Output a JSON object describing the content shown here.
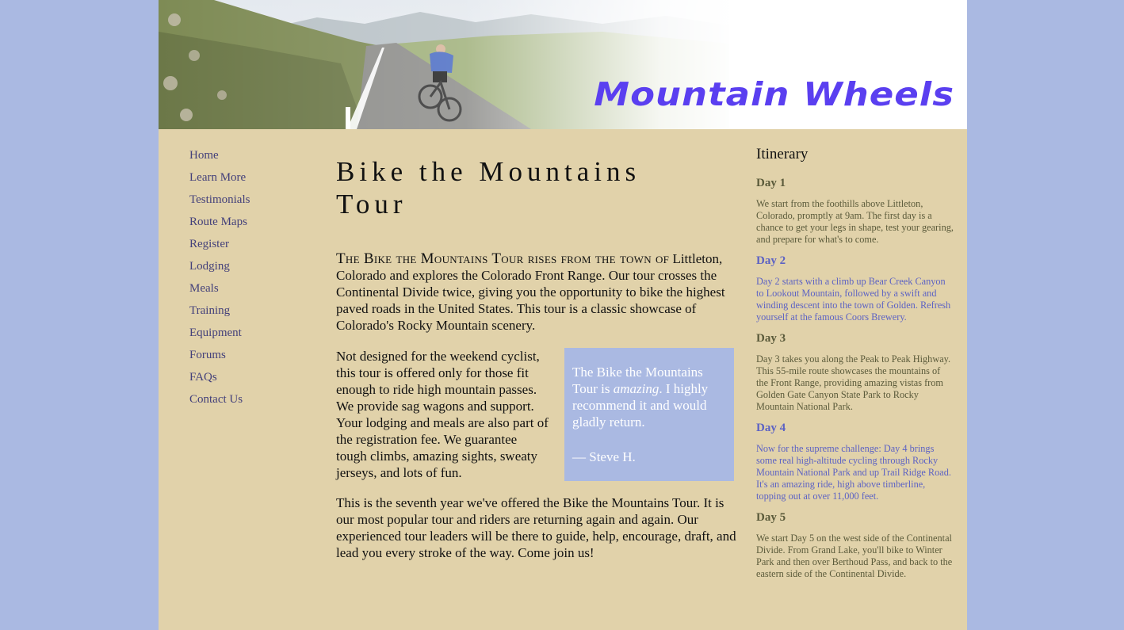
{
  "site": {
    "title": "Mountain Wheels"
  },
  "nav": [
    "Home",
    "Learn More",
    "Testimonials",
    "Route Maps",
    "Register",
    "Lodging",
    "Meals",
    "Training",
    "Equipment",
    "Forums",
    "FAQs",
    "Contact Us"
  ],
  "main": {
    "heading": "Bike the Mountains Tour",
    "lead_first": "The Bike the Mountains Tour rises from the town of",
    "lead_rest": "Littleton, Colorado and explores the Colorado Front Range. Our tour crosses the Continental Divide twice, giving you the opportunity to bike the highest paved roads in the United States. This tour is a classic showcase of Colorado's Rocky Mountain scenery.",
    "para2": "Not designed for the weekend cyclist, this tour is offered only for those fit enough to ride high mountain passes. We provide sag wagons and support. Your lodging and meals are also part of the registration fee. We guarantee tough climbs, amazing sights, sweaty jerseys, and lots of fun.",
    "para3": "This is the seventh year we've offered the Bike the Mountains Tour. It is our most popular tour and riders are returning again and again. Our experienced tour leaders will be there to guide, help, encourage, draft, and lead you every stroke of the way. Come join us!",
    "quote": {
      "before": "The Bike the Mountains Tour is ",
      "emph": "amazing",
      "after": ". I highly recommend it and would gladly return.",
      "author": "— Steve H."
    }
  },
  "itinerary": {
    "title": "Itinerary",
    "days": [
      {
        "label": "Day 1",
        "text": "We start from the foothills above Littleton, Colorado, promptly at 9am. The first day is a chance to get your legs in shape, test your gearing, and prepare for what's to come."
      },
      {
        "label": "Day 2",
        "text": "Day 2 starts with a climb up Bear Creek Canyon to Lookout Mountain, followed by a swift and winding descent into the town of Golden. Refresh yourself at the famous Coors Brewery."
      },
      {
        "label": "Day 3",
        "text": "Day 3 takes you along the Peak to Peak Highway. This 55-mile route showcases the mountains of the Front Range, providing amazing vistas from Golden Gate Canyon State Park to Rocky Mountain National Park."
      },
      {
        "label": "Day 4",
        "text": "Now for the supreme challenge: Day 4 brings some real high-altitude cycling through Rocky Mountain National Park and up Trail Ridge Road. It's an amazing ride, high above timberline, topping out at over 11,000 feet."
      },
      {
        "label": "Day 5",
        "text": "We start Day 5 on the west side of the Continental Divide. From Grand Lake, you'll bike to Winter Park and then over Berthoud Pass, and back to the eastern side of the Continental Divide."
      }
    ]
  }
}
